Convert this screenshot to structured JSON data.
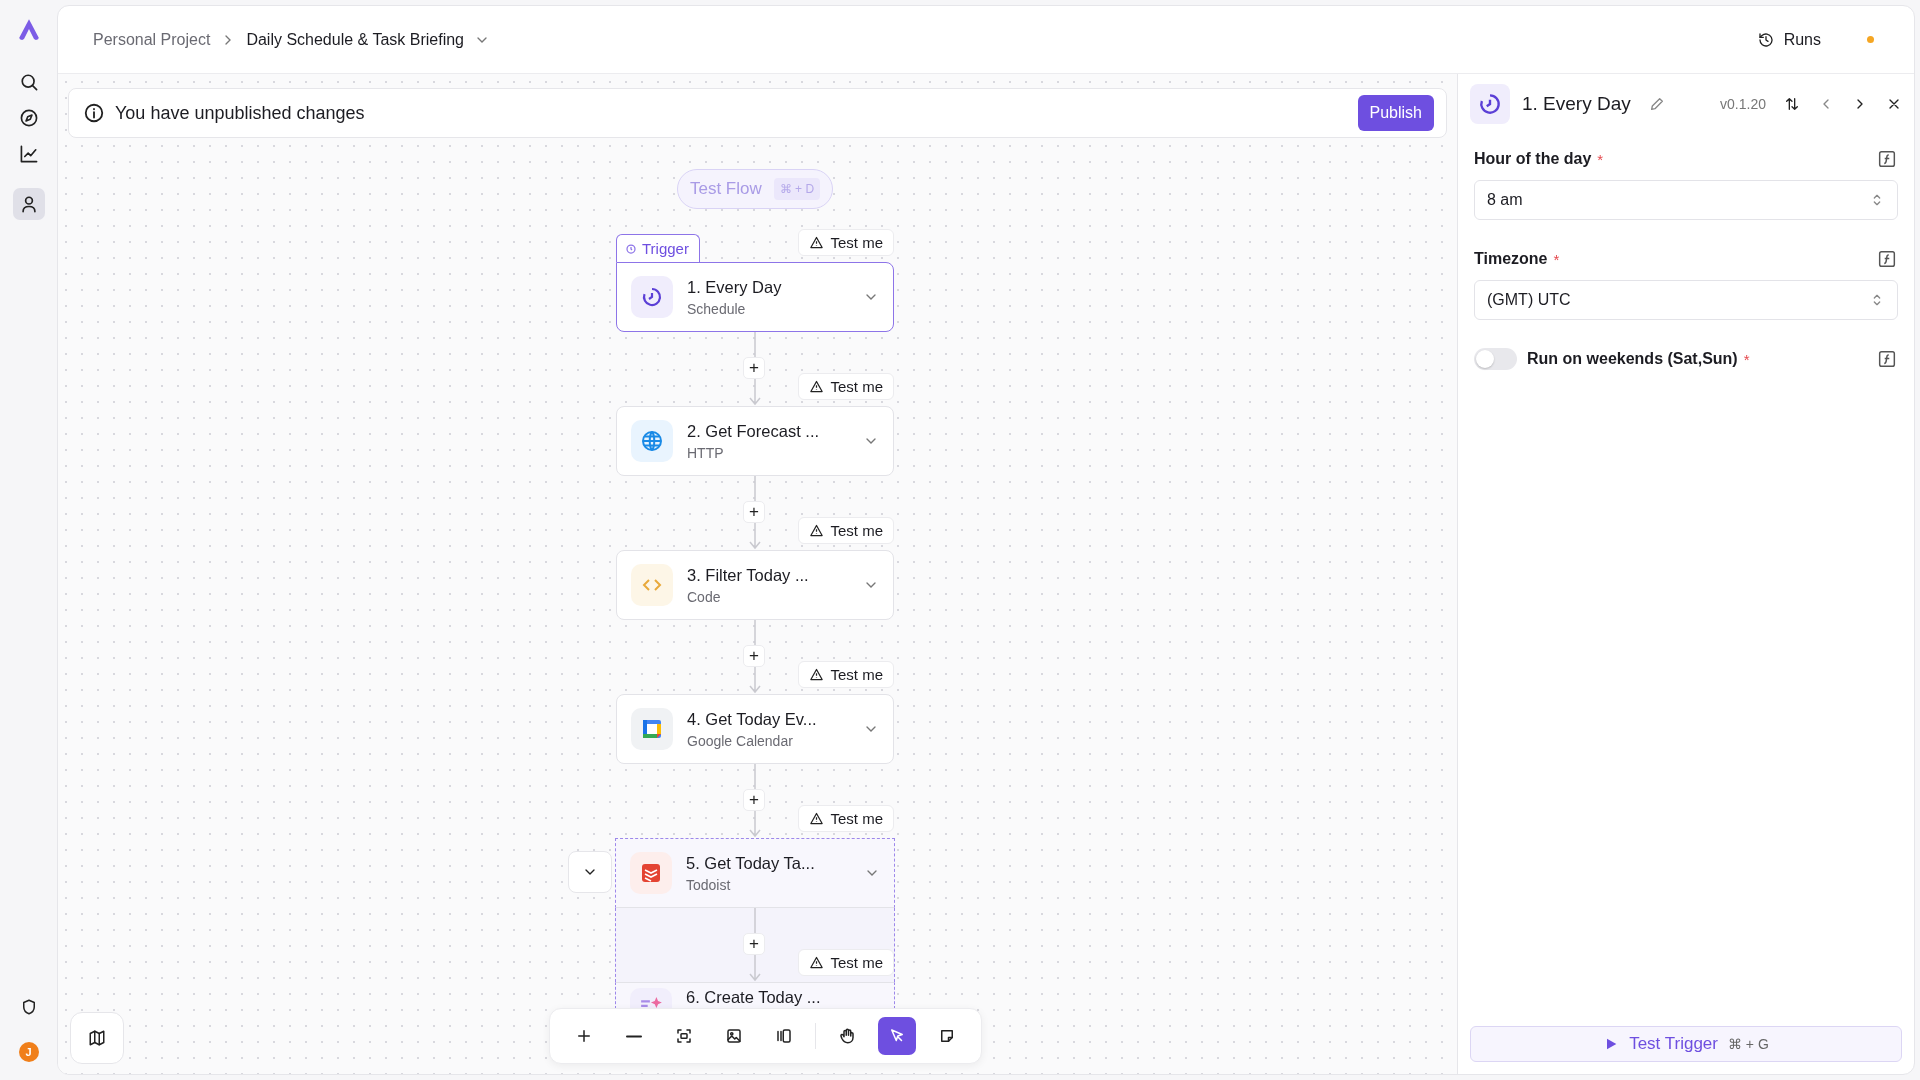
{
  "nav": [
    {
      "kind": "search",
      "selected": false
    },
    {
      "kind": "compass",
      "selected": false
    },
    {
      "kind": "chart",
      "selected": false
    },
    {
      "kind": "user",
      "selected": true
    }
  ],
  "nav_bottom": {
    "avatar": "J"
  },
  "breadcrumb": {
    "project": "Personal Project",
    "flow": "Daily Schedule & Task Briefing"
  },
  "header": {
    "runs": "Runs"
  },
  "banner": {
    "message": "You have unpublished changes",
    "publish": "Publish"
  },
  "test_flow": {
    "label": "Test Flow",
    "shortcut": "⌘ + D"
  },
  "trigger_tag": "Trigger",
  "add_label": "+",
  "steps": [
    {
      "title": "1. Every Day",
      "subtitle": "Schedule",
      "kind": "schedule",
      "test_label": "Test me",
      "selected": true
    },
    {
      "title": "2. Get Forecast ...",
      "subtitle": "HTTP",
      "kind": "http",
      "test_label": "Test me",
      "selected": false
    },
    {
      "title": "3. Filter Today ...",
      "subtitle": "Code",
      "kind": "code",
      "test_label": "Test me",
      "selected": false
    },
    {
      "title": "4. Get Today Ev...",
      "subtitle": "Google Calendar",
      "kind": "calendar",
      "test_label": "Test me",
      "selected": false
    },
    {
      "title": "5. Get Today Ta...",
      "subtitle": "Todoist",
      "kind": "todoist",
      "test_label": "Test me",
      "selected": false,
      "expanded": true,
      "children": [
        {
          "title": "6. Create Today ...",
          "kind": "ai",
          "test_label": "Test me",
          "selected": false
        }
      ]
    }
  ],
  "tools": [
    {
      "kind": "zoom-in",
      "selected": false
    },
    {
      "kind": "zoom-out",
      "selected": false
    },
    {
      "kind": "fit",
      "selected": false
    },
    {
      "kind": "image",
      "selected": false
    },
    {
      "kind": "columns",
      "selected": false
    },
    {
      "kind": "hand",
      "selected": false
    },
    {
      "kind": "pointer",
      "selected": true
    },
    {
      "kind": "note",
      "selected": false
    }
  ],
  "panel": {
    "title": "1. Every Day",
    "version": "v0.1.20",
    "required_mark": "*",
    "fields": [
      {
        "kind": "select",
        "label": "Hour of the day",
        "required": true,
        "value": "8 am"
      },
      {
        "kind": "select",
        "label": "Timezone",
        "required": true,
        "value": "(GMT) UTC"
      },
      {
        "kind": "toggle",
        "label": "Run on weekends (Sat,Sun)",
        "required": true,
        "on": false
      }
    ],
    "test_trigger": {
      "label": "Test Trigger",
      "shortcut": "⌘ + G"
    }
  }
}
